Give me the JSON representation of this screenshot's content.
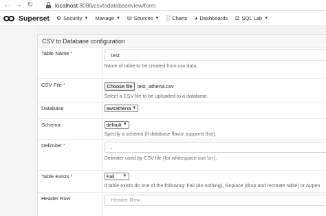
{
  "browser": {
    "url_host": "localhost",
    "url_path": ":8088/csvtodatabaseview/form"
  },
  "navbar": {
    "brand": "Superset",
    "menu": [
      {
        "label": "Security",
        "icon": "gear-icon"
      },
      {
        "label": "Manage",
        "icon": ""
      },
      {
        "label": "Sources",
        "icon": "database-icon"
      },
      {
        "label": "Charts",
        "icon": "bar-chart-icon"
      },
      {
        "label": "Dashboards",
        "icon": "dashboard-icon"
      },
      {
        "label": "SQL Lab",
        "icon": "flask-icon"
      }
    ]
  },
  "form": {
    "heading": "CSV to Database configuration",
    "table_name": {
      "label": "Table Name",
      "required": "*",
      "value": "test",
      "help": "Name of table to be created from csv data."
    },
    "csv_file": {
      "label": "CSV File",
      "required": "*",
      "button": "Choose file",
      "file_name": "test_athena.csv",
      "help": "Select a CSV file to be uploaded to a database."
    },
    "database": {
      "label": "Database",
      "selected": "awsathena"
    },
    "schema": {
      "label": "Schema",
      "selected": "default",
      "help": "Specify a schema (if database flavor supports this)."
    },
    "delimiter": {
      "label": "Delimiter",
      "required": "*",
      "value": ",",
      "help": "Delimiter used by CSV file (for whitespace use \\s+)."
    },
    "table_exists": {
      "label": "Table Exists",
      "required": "*",
      "selected": "Fail",
      "help": "If table exists do one of the following: Fail (do nothing), Replace (drop and recreate table) or Appen"
    },
    "header_row": {
      "label": "Header Row",
      "placeholder": "Header Row"
    }
  }
}
